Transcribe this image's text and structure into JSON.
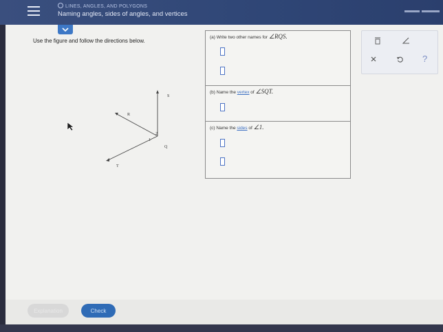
{
  "header": {
    "breadcrumb": "LINES, ANGLES, AND POLYGONS",
    "title": "Naming angles, sides of angles, and vertices",
    "bg_color": "#2f4676"
  },
  "main": {
    "instructions": "Use the figure and follow the directions below."
  },
  "figure": {
    "labels": {
      "S": "S",
      "R": "R",
      "T": "T",
      "Q": "Q",
      "one": "1",
      "two": "2"
    }
  },
  "answers": {
    "part_a": {
      "prefix": "(a) Write two other names for ",
      "symbol": "∠",
      "angle": "RQS",
      "suffix": "."
    },
    "part_b": {
      "prefix": "(b) Name the ",
      "link": "vertex",
      "middle": " of ",
      "symbol": "∠",
      "angle": "SQT",
      "suffix": "."
    },
    "part_c": {
      "prefix": "(c) Name the ",
      "link": "sides",
      "middle": " of ",
      "symbol": "∠",
      "angle": "1",
      "suffix": "."
    }
  },
  "tools": {
    "row1": [
      "fraction-bar-icon",
      "angle-icon"
    ],
    "row2": [
      "clear-icon",
      "undo-icon",
      "help-icon"
    ],
    "help_label": "?"
  },
  "footer": {
    "explanation_label": "Explanation",
    "check_label": "Check",
    "accent_color": "#2f6bb6"
  }
}
